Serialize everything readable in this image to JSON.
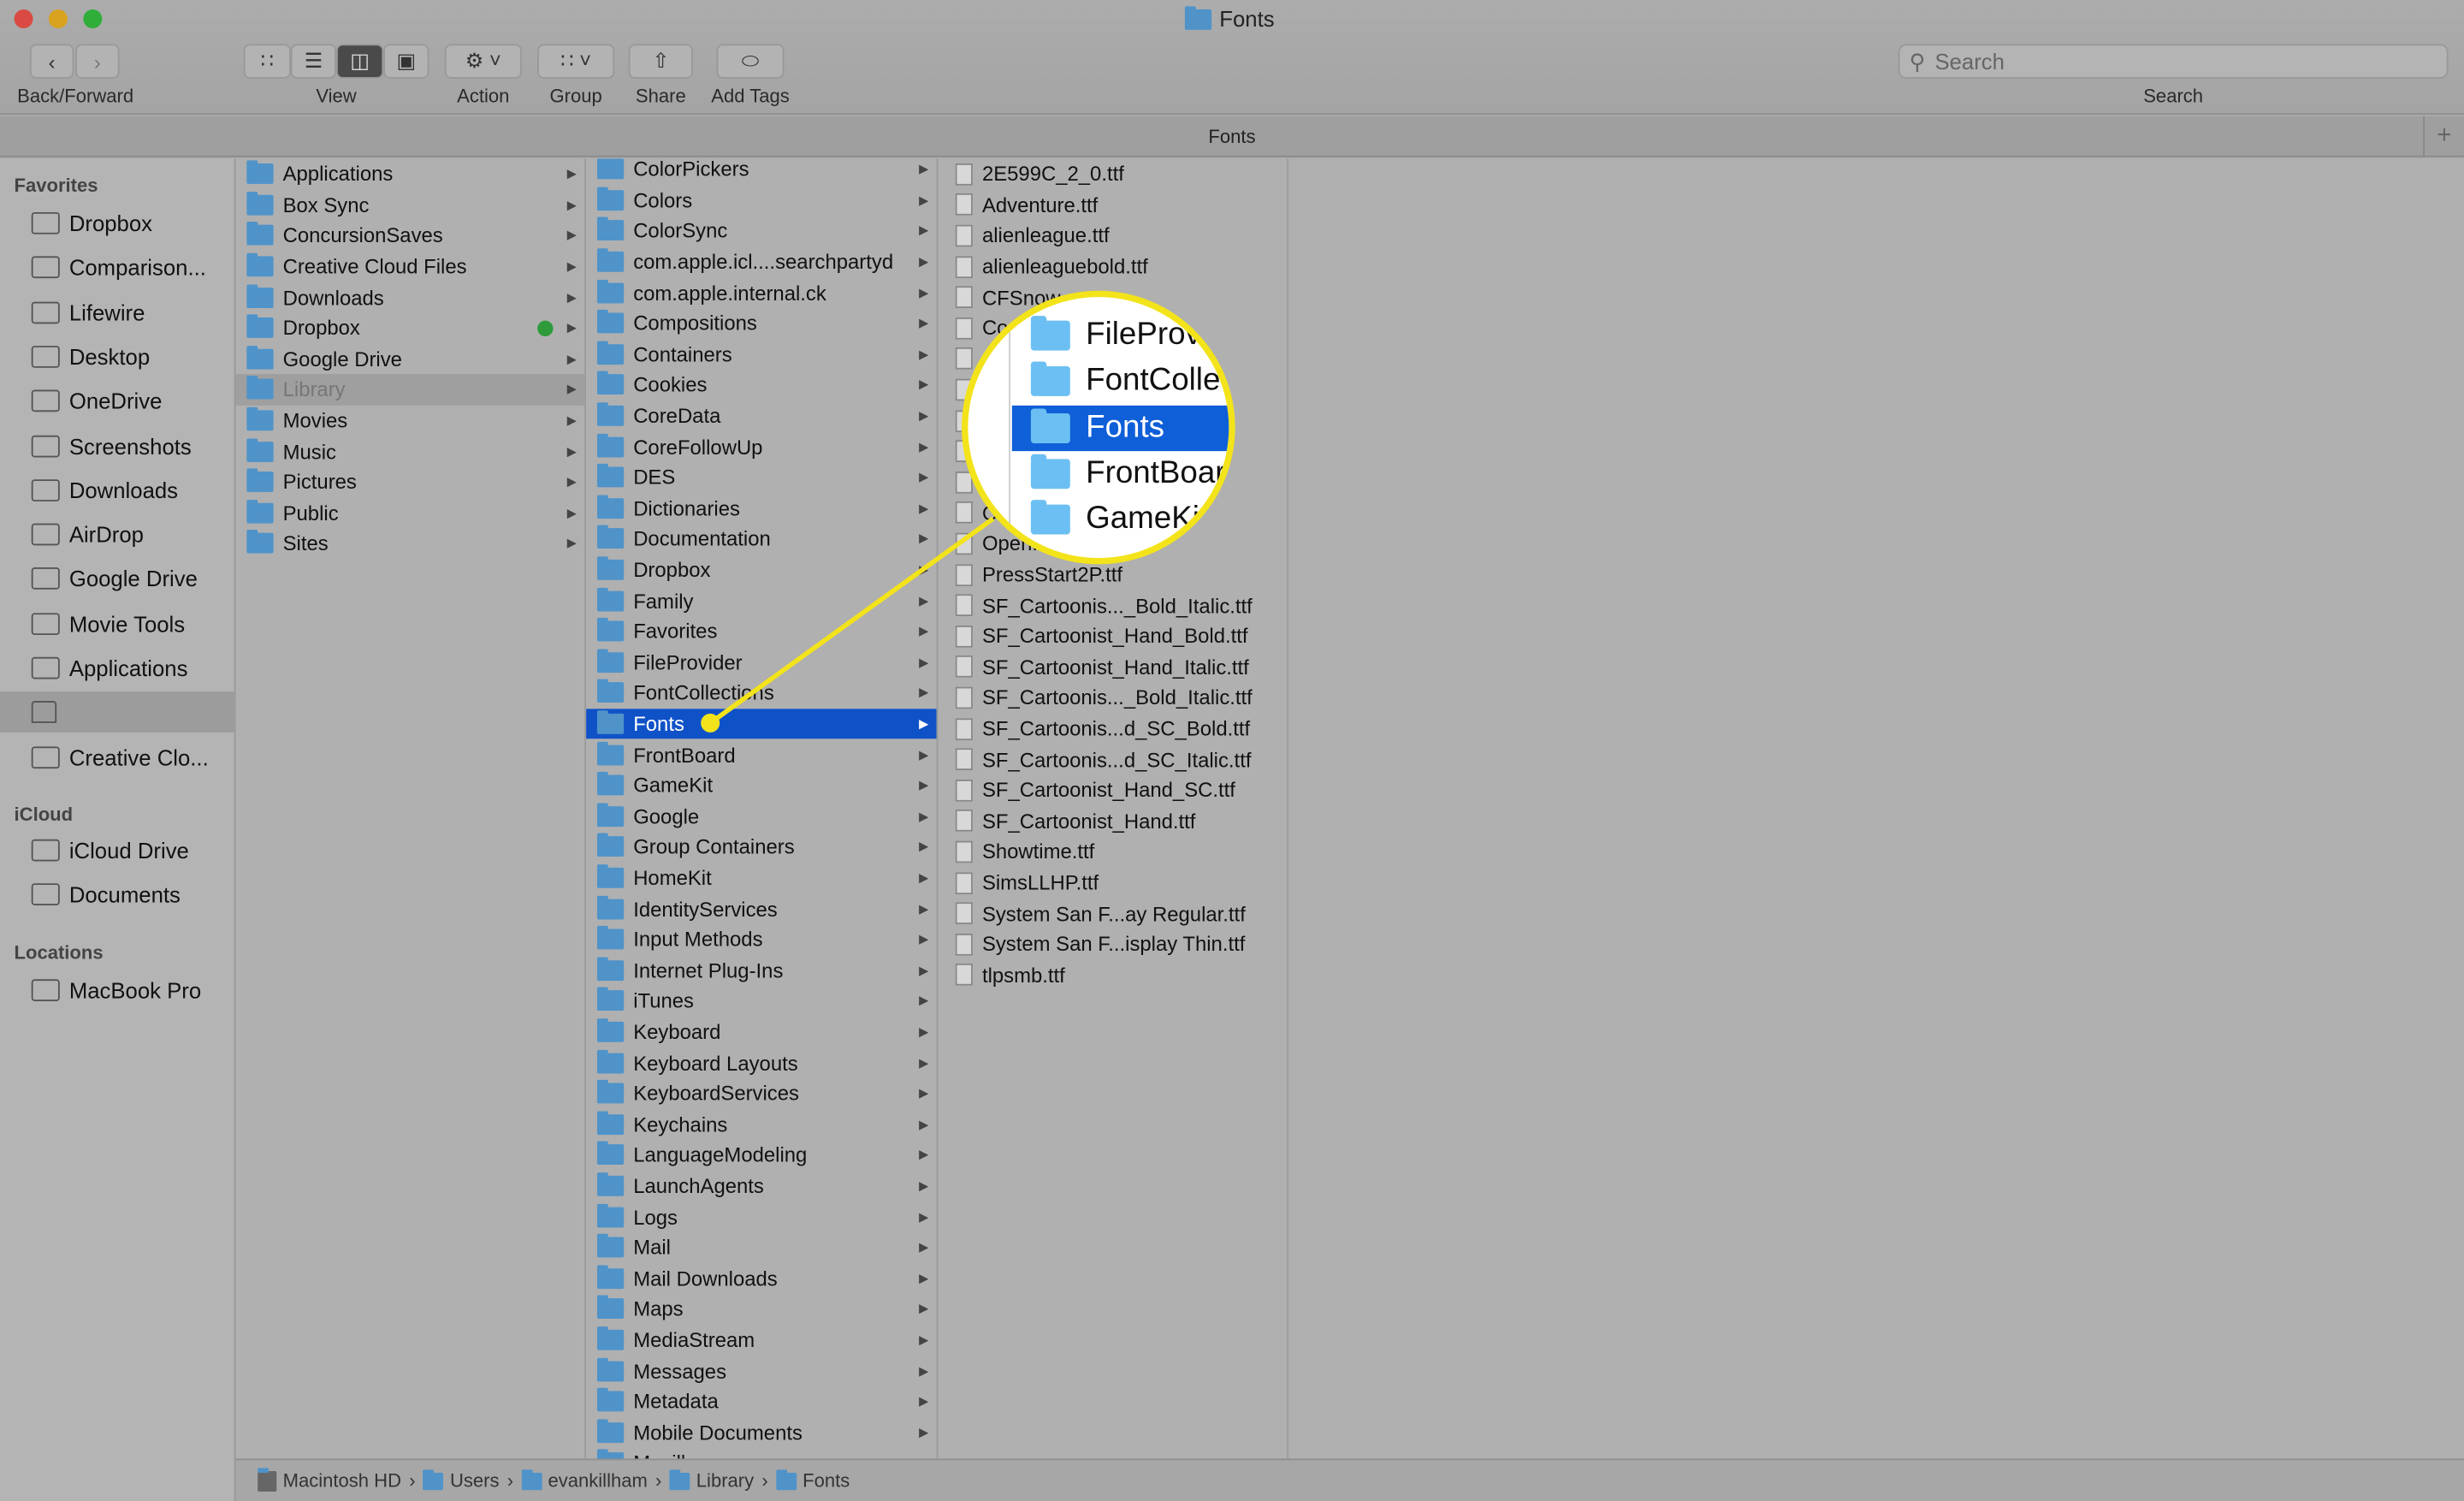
{
  "window": {
    "title": "Fonts",
    "tab_title": "Fonts"
  },
  "toolbar": {
    "back_forward": "Back/Forward",
    "view": "View",
    "action": "Action",
    "group": "Group",
    "share": "Share",
    "add_tags": "Add Tags",
    "search_label": "Search",
    "search_placeholder": "Search"
  },
  "sidebar": {
    "favorites_header": "Favorites",
    "favorites": [
      {
        "label": "Dropbox"
      },
      {
        "label": "Comparison..."
      },
      {
        "label": "Lifewire"
      },
      {
        "label": "Desktop"
      },
      {
        "label": "OneDrive"
      },
      {
        "label": "Screenshots"
      },
      {
        "label": "Downloads"
      },
      {
        "label": "AirDrop"
      },
      {
        "label": "Google Drive"
      },
      {
        "label": "Movie Tools"
      },
      {
        "label": "Applications"
      },
      {
        "label": "",
        "icon": "home-icon",
        "selected": true
      },
      {
        "label": "Creative Clo..."
      }
    ],
    "icloud_header": "iCloud",
    "icloud": [
      {
        "label": "iCloud Drive"
      },
      {
        "label": "Documents"
      }
    ],
    "locations_header": "Locations",
    "locations": [
      {
        "label": "MacBook Pro"
      }
    ]
  },
  "column1": [
    "Applications",
    "Box Sync",
    "ConcursionSaves",
    "Creative Cloud Files",
    "Downloads",
    "Dropbox",
    "Google Drive",
    "Library",
    "Movies",
    "Music",
    "Pictures",
    "Public",
    "Sites"
  ],
  "column1_selected": "Library",
  "column1_synced": "Dropbox",
  "column2": [
    "ColorPickers",
    "Colors",
    "ColorSync",
    "com.apple.icl....searchpartyd",
    "com.apple.internal.ck",
    "Compositions",
    "Containers",
    "Cookies",
    "CoreData",
    "CoreFollowUp",
    "DES",
    "Dictionaries",
    "Documentation",
    "Dropbox",
    "Family",
    "Favorites",
    "FileProvider",
    "FontCollections",
    "Fonts",
    "FrontBoard",
    "GameKit",
    "Google",
    "Group Containers",
    "HomeKit",
    "IdentityServices",
    "Input Methods",
    "Internet Plug-Ins",
    "iTunes",
    "Keyboard",
    "Keyboard Layouts",
    "KeyboardServices",
    "Keychains",
    "LanguageModeling",
    "LaunchAgents",
    "Logs",
    "Mail",
    "Mail Downloads",
    "Maps",
    "MediaStream",
    "Messages",
    "Metadata",
    "Mobile Documents",
    "Mozilla"
  ],
  "column2_selected": "Fonts",
  "column3": [
    "2E599C_2_0.ttf",
    "Adventure.ttf",
    "alienleague.ttf",
    "alienleaguebold.ttf",
    "CFSnow",
    "Co",
    "",
    "",
    "",
    "",
    "",
    "O",
    "Open...old.ttf",
    "PressStart2P.ttf",
    "SF_Cartoonis..._Bold_Italic.ttf",
    "SF_Cartoonist_Hand_Bold.ttf",
    "SF_Cartoonist_Hand_Italic.ttf",
    "SF_Cartoonis..._Bold_Italic.ttf",
    "SF_Cartoonis...d_SC_Bold.ttf",
    "SF_Cartoonis...d_SC_Italic.ttf",
    "SF_Cartoonist_Hand_SC.ttf",
    "SF_Cartoonist_Hand.ttf",
    "Showtime.ttf",
    "SimsLLHP.ttf",
    "System San F...ay Regular.ttf",
    "System San F...isplay Thin.ttf",
    "tlpsmb.ttf"
  ],
  "magnifier": {
    "items": [
      "FileProv",
      "FontCollec",
      "Fonts",
      "FrontBoar",
      "GameKit"
    ],
    "selected": "Fonts"
  },
  "pathbar": [
    "Macintosh HD",
    "Users",
    "evankillham",
    "Library",
    "Fonts"
  ],
  "colors": {
    "selection": "#0f52c8",
    "highlight_yellow": "#f3e31a",
    "folder": "#4f93c9"
  }
}
